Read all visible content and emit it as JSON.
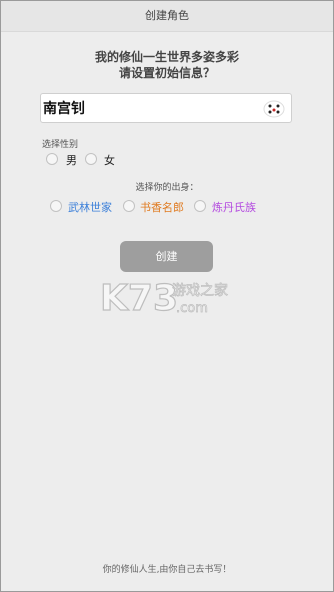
{
  "header": {
    "title": "创建角色"
  },
  "prompt": {
    "line1": "我的修仙一生世界多姿多彩",
    "line2": "请设置初始信息？"
  },
  "name_field": {
    "value": "南宫钊"
  },
  "gender": {
    "label": "选择性别",
    "options": [
      {
        "label": "男"
      },
      {
        "label": "女"
      }
    ]
  },
  "origin": {
    "label": "选择你的出身：",
    "options": [
      {
        "label": "武林世家",
        "color": "#3b7fd9"
      },
      {
        "label": "书香名郎",
        "color": "#e07a1f"
      },
      {
        "label": "炼丹氏族",
        "color": "#b44be0"
      }
    ]
  },
  "create_button": {
    "label": "创建"
  },
  "watermark": {
    "text": "K73",
    "cn": "游戏之家",
    "url": ".com"
  },
  "footer": {
    "text": "你的修仙人生,由你自己去书写！"
  }
}
